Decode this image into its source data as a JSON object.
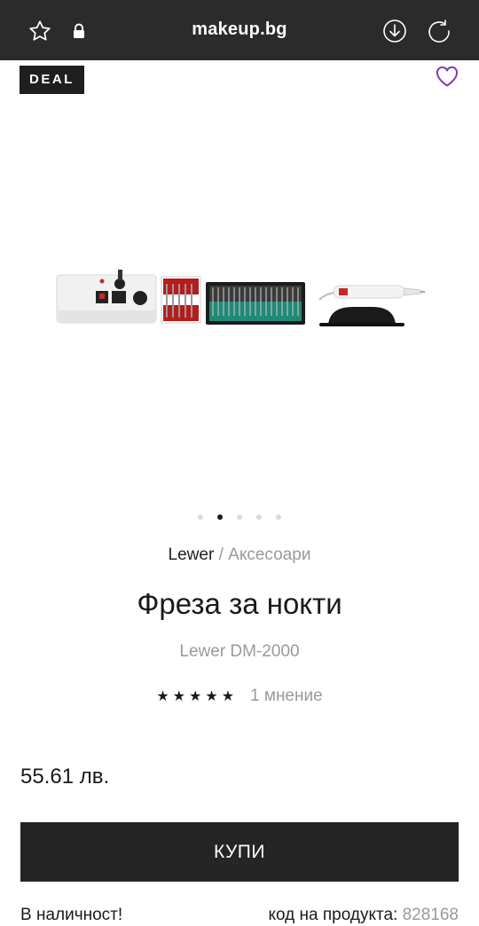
{
  "browser": {
    "url": "makeup.bg",
    "icons": [
      "star-icon",
      "lock-icon",
      "download-icon",
      "reload-icon"
    ]
  },
  "badge": {
    "label": "DEAL"
  },
  "wishlist": {
    "icon": "heart-icon",
    "color": "#7b3fb3"
  },
  "carousel": {
    "dot_count": 5,
    "active_index": 1
  },
  "breadcrumb": {
    "brand": "Lewer",
    "separator": "/",
    "category": "Аксесоари"
  },
  "product": {
    "title": "Фреза за нокти",
    "model": "Lewer DM-2000",
    "rating_stars": "★★★★★",
    "rating_value": 5,
    "reviews_text": "1 мнение",
    "price": "55.61 лв."
  },
  "buy": {
    "label": "КУПИ"
  },
  "stock": {
    "text": "В наличност!"
  },
  "code": {
    "label": "код на продукта:",
    "value": "828168"
  },
  "colors": {
    "topbar": "#2b2b2b",
    "button": "#252525",
    "accent": "#7b3fb3",
    "muted": "#9a9a9a"
  }
}
